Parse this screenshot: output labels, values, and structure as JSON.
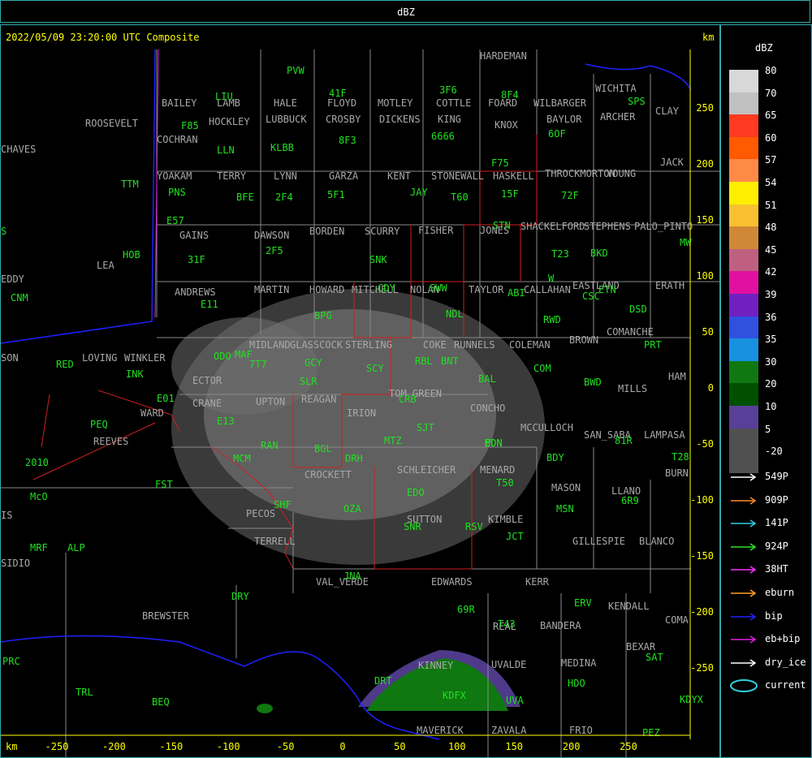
{
  "header": {
    "title": "dBZ"
  },
  "map": {
    "timestamp": "2022/05/09 23:20:00 UTC Composite",
    "unit_top": "km",
    "unit_bottom": "km",
    "x_ticks": [
      "-250",
      "-200",
      "-150",
      "-100",
      "-50",
      "0",
      "50",
      "100",
      "150",
      "200",
      "250"
    ],
    "y_ticks": [
      "250",
      "200",
      "150",
      "100",
      "50",
      "0",
      "-50",
      "-100",
      "-150",
      "-200",
      "-250"
    ],
    "counties": [
      "BAILEY",
      "LAMB",
      "HALE",
      "FLOYD",
      "MOTLEY",
      "COTTLE",
      "FOARD",
      "WILBARGER",
      "WICHITA",
      "CLAY",
      "HARDEMAN",
      "ROOSEVELT",
      "COCHRAN",
      "HOCKLEY",
      "LUBBUCK",
      "CROSBY",
      "DICKENS",
      "KING",
      "KNOX",
      "BAYLOR",
      "ARCHER",
      "CHAVES",
      "YOAKAM",
      "TERRY",
      "LYNN",
      "GARZA",
      "KENT",
      "STONEWALL",
      "HASKELL",
      "THROCKMORTON",
      "YOUNG",
      "JACK",
      "GAINS",
      "DAWSON",
      "BORDEN",
      "SCURRY",
      "FISHER",
      "JONES",
      "SHACKELFORD",
      "STEPHENS",
      "PALO_PINTO",
      "LEA",
      "ANDREWS",
      "MARTIN",
      "HOWARD",
      "MITCHELL",
      "NOLAN",
      "TAYLOR",
      "CALLAHAN",
      "EASTLAND",
      "ERATH",
      "EDDY",
      "LOVING",
      "WINKLER",
      "ECTOR",
      "MIDLAND",
      "GLASSCOCK",
      "STERLING",
      "COKE",
      "RUNNELS",
      "COLEMAN",
      "BROWN",
      "COMANCHE",
      "HAM",
      "WARD",
      "CRANE",
      "UPTON",
      "REAGAN",
      "IRION",
      "TOM GREEN",
      "CONCHO",
      "MCCULLOCH",
      "MILLS",
      "REEVES",
      "SAN_SABA",
      "LAMPASA",
      "CROCKETT",
      "SCHLEICHER",
      "MENARD",
      "MASON",
      "LLANO",
      "BURN",
      "PECOS",
      "SUTTON",
      "KIMBLE",
      "GILLESPIE",
      "BLANCO",
      "TERRELL",
      "VAL_VERDE",
      "EDWARDS",
      "KERR",
      "KENDALL",
      "COMA",
      "BREWSTER",
      "REAL",
      "BANDERA",
      "BEXAR",
      "KINNEY",
      "UVALDE",
      "MEDINA",
      "MAVERICK",
      "ZAVALA",
      "FRIO",
      "SIDIO",
      "IS",
      "SON"
    ],
    "stations": [
      "PVW",
      "LIU",
      "41F",
      "3F6",
      "8F4",
      "SPS",
      "F85",
      "LLN",
      "KLBB",
      "8F3",
      "6666",
      "6OF",
      "F75",
      "TTM",
      "PNS",
      "BFE",
      "2F4",
      "5F1",
      "JAY",
      "T60",
      "15F",
      "72F",
      "E57",
      "S",
      "HOB",
      "31F",
      "2F5",
      "SNK",
      "STN",
      "T23",
      "BKD",
      "MW",
      "CNM",
      "E11",
      "BPG",
      "CDY",
      "SWW",
      "NDL",
      "ABI",
      "CSC",
      "ETN",
      "DSD",
      "ODO",
      "MAF",
      "7T7",
      "GCY",
      "SCY",
      "RBL",
      "BNT",
      "COM",
      "PRT",
      "RED",
      "INK",
      "SLR",
      "BAL",
      "RWD",
      "BWD",
      "E01",
      "E13",
      "CRB",
      "SJT",
      "MDN",
      "BDY",
      "81R",
      "PEQ",
      "RAN",
      "BGL",
      "DRH",
      "MTZ",
      "EDN",
      "T28",
      "MCM",
      "T50",
      "2010",
      "FST",
      "EDO",
      "MSN",
      "6R9",
      "McO",
      "SHF",
      "OZA",
      "SNR",
      "RSV",
      "JCT",
      "MRF",
      "ALP",
      "JNA",
      "69R",
      "DRY",
      "ERV",
      "T43",
      "PRC",
      "TRL",
      "BEQ",
      "DRT",
      "KDFX",
      "UVA",
      "HDO",
      "SAT",
      "PEZ",
      "KDYX",
      "W"
    ]
  },
  "legend": {
    "title": "dBZ",
    "entries": [
      {
        "label": "80",
        "color": "#d8d8d8"
      },
      {
        "label": "70",
        "color": "#c0c0c0"
      },
      {
        "label": "65",
        "color": "#ff3a20"
      },
      {
        "label": "60",
        "color": "#ff5a00"
      },
      {
        "label": "57",
        "color": "#ff8a48"
      },
      {
        "label": "54",
        "color": "#ffee00"
      },
      {
        "label": "51",
        "color": "#f8c030"
      },
      {
        "label": "48",
        "color": "#d08838"
      },
      {
        "label": "45",
        "color": "#c06080"
      },
      {
        "label": "42",
        "color": "#e010a0"
      },
      {
        "label": "39",
        "color": "#7020c0"
      },
      {
        "label": "36",
        "color": "#3050e0"
      },
      {
        "label": "35",
        "color": "#1890e0"
      },
      {
        "label": "30",
        "color": "#107810"
      },
      {
        "label": "20",
        "color": "#005000"
      },
      {
        "label": "10",
        "color": "#584098"
      },
      {
        "label": "5",
        "color": "#505050"
      },
      {
        "label": "-20",
        "color": "#505050"
      }
    ],
    "line_keys": [
      {
        "label": "549P",
        "color": "#ffffff"
      },
      {
        "label": "909P",
        "color": "#ff8c2a"
      },
      {
        "label": "141P",
        "color": "#30d0e0"
      },
      {
        "label": "924P",
        "color": "#30e030"
      },
      {
        "label": "38HT",
        "color": "#ff30ff"
      },
      {
        "label": "eburn",
        "color": "#ffa020"
      },
      {
        "label": "bip",
        "color": "#2020ff"
      },
      {
        "label": "eb+bip",
        "color": "#e020e0"
      },
      {
        "label": "dry_ice",
        "color": "#ffffff"
      },
      {
        "label": "current",
        "color": "#30d0e0"
      }
    ]
  }
}
